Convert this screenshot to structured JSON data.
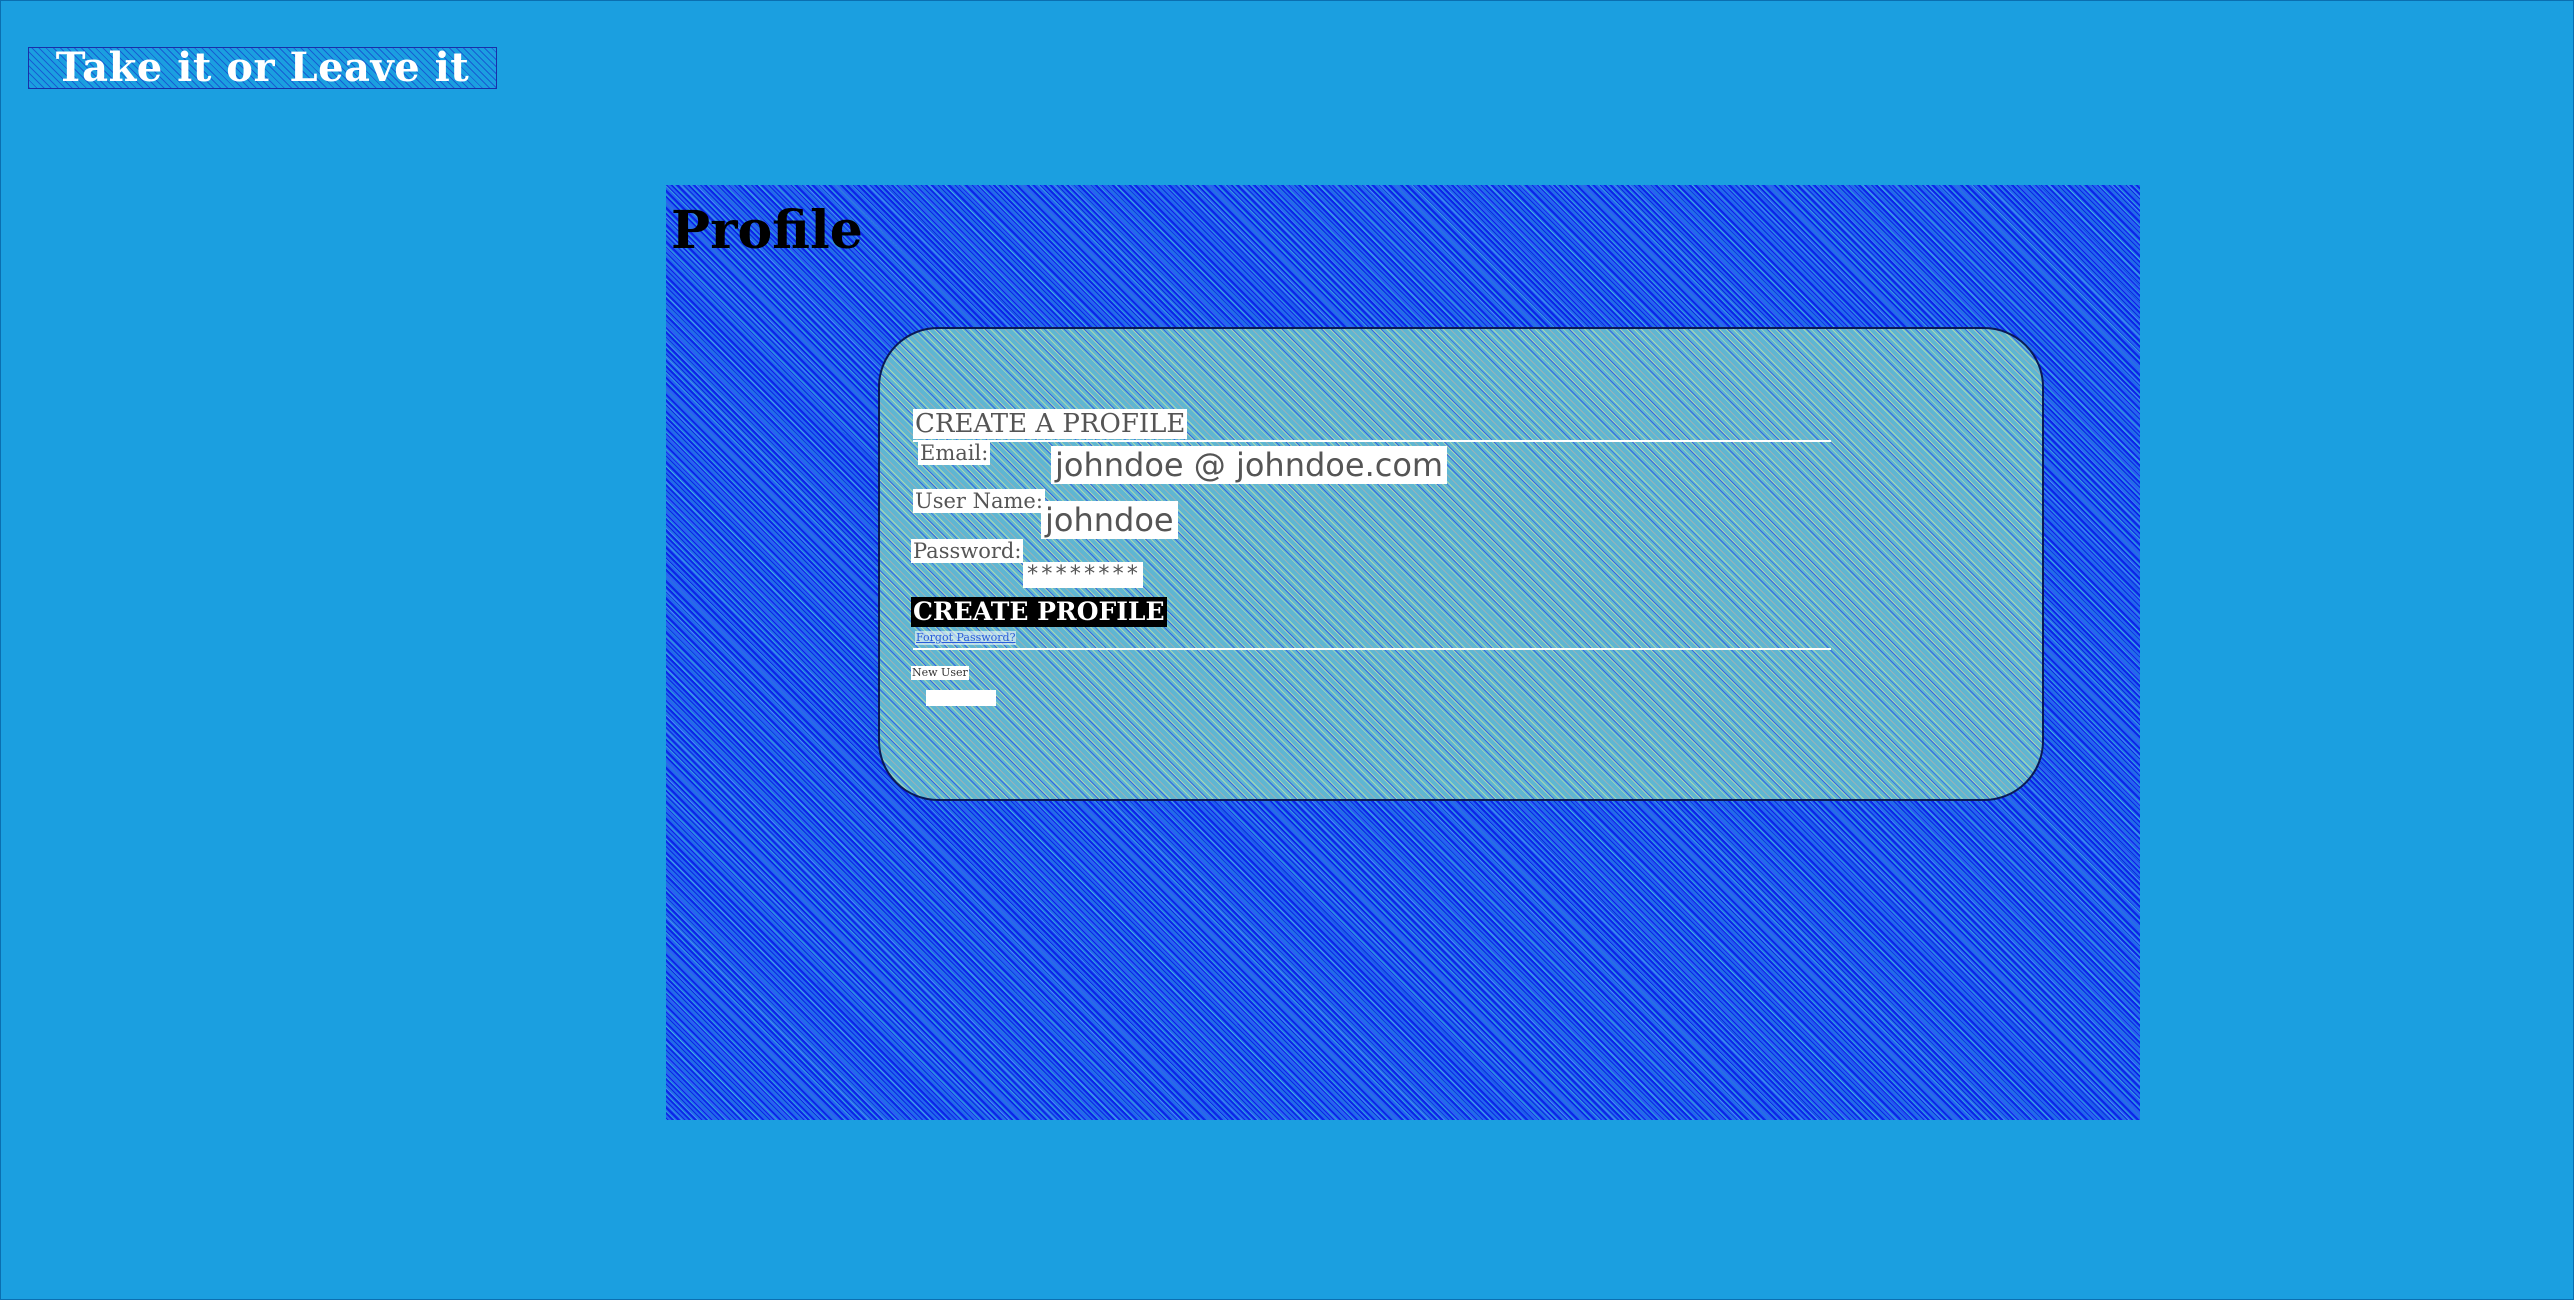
{
  "app": {
    "logo_text": "Take it or Leave it"
  },
  "page": {
    "title": "Profile"
  },
  "form": {
    "title": "CREATE A PROFILE",
    "email_label": "Email:",
    "email_value": "johndoe @ johndoe.com",
    "username_label": "User Name:",
    "username_value": "johndoe",
    "password_label": "Password:",
    "password_value": "********",
    "submit_label": "CREATE PROFILE",
    "forgot_password_label": "Forgot Password?",
    "new_user_label": "New User",
    "new_user_link_label": ""
  },
  "colors": {
    "page_background": "#1b9fe0",
    "panel_blue": "#2366f0",
    "submit_background": "#000000",
    "text_white": "#ffffff"
  }
}
